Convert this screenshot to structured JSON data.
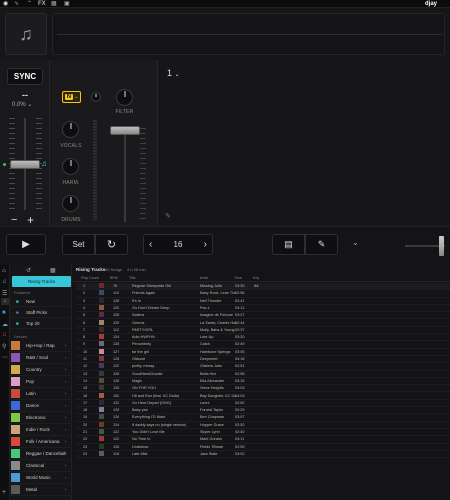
{
  "topbar": {
    "logo": "djay",
    "tabs": [
      "FX"
    ]
  },
  "deck": {
    "sync": "SYNC",
    "bpm": "--",
    "pitch": "0.0%",
    "track_number": "1",
    "neural_mix_badge": "N",
    "vocals": "VOCALS",
    "harmonic": "HARM.",
    "drums": "DRUMS",
    "filter": "FILTER",
    "minus": "−",
    "plus": "+"
  },
  "transport": {
    "play": "▶",
    "set": "Set",
    "loop_value": "16",
    "prev": "‹",
    "next": "›"
  },
  "library": {
    "header_title": "Rising Tracks",
    "header_count": "80 Songs",
    "header_duration": "4 h 28 min",
    "sidebar": {
      "active": "Rising Tracks",
      "featured_label": "Featured",
      "featured": [
        "New",
        "Staff Picks",
        "Top 20"
      ],
      "genres_label": "Genres",
      "genres": [
        "Hip-Hop / Rap",
        "R&B / Soul",
        "Country",
        "Pop",
        "Latin",
        "Dance",
        "Electronic",
        "Indie / Rock",
        "Folk / Americana",
        "Reggae / Dancehall",
        "Classical",
        "World Music",
        "Metal"
      ]
    },
    "columns": [
      "Play Count",
      "BPM",
      "Title",
      "Artist",
      "Time",
      "Key"
    ],
    "rows": [
      {
        "pc": "1",
        "bpm": "76",
        "title": "Regular Sheepside Girl",
        "artist": "Missing Jolla",
        "time": "03:30",
        "key": "8A",
        "c": "#6b2b2b"
      },
      {
        "pc": "2",
        "bpm": "110",
        "title": "Friends Again",
        "artist": "Baby Rock, Lean Thunder",
        "time": "02:58",
        "key": "",
        "c": "#3a4a6a"
      },
      {
        "pc": "3",
        "bpm": "128",
        "title": "It's In",
        "artist": "Neil Thunder",
        "time": "02:41",
        "key": "",
        "c": "#2a2a2a"
      },
      {
        "pc": "4",
        "bpm": "120",
        "title": "Go Don't Dream Deep",
        "artist": "Pav-1",
        "time": "03:12",
        "key": "",
        "c": "#8a5a3a"
      },
      {
        "pc": "5",
        "bpm": "128",
        "title": "Satiera",
        "artist": "Imagine de Fortune",
        "time": "03:27",
        "key": "",
        "c": "#5a2a4a"
      },
      {
        "pc": "6",
        "bpm": "125",
        "title": "Greens",
        "artist": "La Santa, Charlie Hunter",
        "time": "02:44",
        "key": "",
        "c": "#9a8a6a"
      },
      {
        "pc": "7",
        "bpm": "112",
        "title": "PARTYGIRL",
        "artist": "Molly, Babs & Young",
        "time": "02:37",
        "key": "",
        "c": "#3a2a2a"
      },
      {
        "pc": "8",
        "bpm": "124",
        "title": "Adio HWFHN",
        "artist": "Lute-Up",
        "time": "03:20",
        "key": "",
        "c": "#aa3a3a"
      },
      {
        "pc": "9",
        "bpm": "126",
        "title": "Penumbrity",
        "artist": "Catch",
        "time": "02:49",
        "key": "",
        "c": "#6a6a7a"
      },
      {
        "pc": "10",
        "bpm": "127",
        "title": "far the girl",
        "artist": "Hambone Springs",
        "time": "03:05",
        "key": "",
        "c": "#c88aa0"
      },
      {
        "pc": "11",
        "bpm": "128",
        "title": "Oldcore",
        "artist": "Deepmeet",
        "time": "03:18",
        "key": "",
        "c": "#7a3a3a"
      },
      {
        "pc": "12",
        "bpm": "120",
        "title": "pretty, messy",
        "artist": "Glisters Jobs",
        "time": "02:51",
        "key": "",
        "c": "#4a3a5a"
      },
      {
        "pc": "13",
        "bpm": "128",
        "title": "GoodNeedGoodie",
        "artist": "Bella Hex",
        "time": "02:58",
        "key": "",
        "c": "#2a3a4a"
      },
      {
        "pc": "14",
        "bpm": "126",
        "title": "Magic",
        "artist": "Ella Alexander",
        "time": "03:15",
        "key": "",
        "c": "#5a4a3a"
      },
      {
        "pc": "15",
        "bpm": "126",
        "title": "ON FOR YOU",
        "artist": "Steve Heights",
        "time": "03:03",
        "key": "",
        "c": "#3a3a3a"
      },
      {
        "pc": "16",
        "bpm": "100",
        "title": "Hit and Run (feat. KC Dolla)",
        "artist": "Bay Daughter, KC Dolla",
        "time": "04:03",
        "key": "",
        "c": "#aa5a4a"
      },
      {
        "pc": "17",
        "bpm": "122",
        "title": "Go Here Depart (ONG)",
        "artist": "Lenni",
        "time": "02:52",
        "key": "",
        "c": "#2a2a3a"
      },
      {
        "pc": "18",
        "bpm": "128",
        "title": "Baby yes",
        "artist": "Forrest Taylor",
        "time": "02:29",
        "key": "",
        "c": "#8a7a9a"
      },
      {
        "pc": "19",
        "bpm": "126",
        "title": "Everything I'D Want",
        "artist": "Ben Chapman",
        "time": "03:07",
        "key": "",
        "c": "#4a4a4a"
      },
      {
        "pc": "20",
        "bpm": "124",
        "title": "If daddy says no (single version)",
        "artist": "Hopper Grace",
        "time": "02:52",
        "key": "",
        "c": "#6a3a2a"
      },
      {
        "pc": "21",
        "bpm": "122",
        "title": "You Didn't Love Me",
        "artist": "Skyler Lynn",
        "time": "02:40",
        "key": "",
        "c": "#3a5a4a"
      },
      {
        "pc": "22",
        "bpm": "120",
        "title": "No Time In",
        "artist": "Mark Gordon",
        "time": "03:11",
        "key": "",
        "c": "#9a3a3a"
      },
      {
        "pc": "23",
        "bpm": "126",
        "title": "Undertow",
        "artist": "Fields Tillman",
        "time": "02:59",
        "key": "",
        "c": "#2a3a2a"
      },
      {
        "pc": "24",
        "bpm": "118",
        "title": "Late Mist",
        "artist": "Jack Slate",
        "time": "03:02",
        "key": "",
        "c": "#5a5a6a"
      }
    ]
  },
  "colors": {
    "accent": "#38c6d9",
    "badge": "#f5c518",
    "bg": "#111113",
    "panel": "#1c1c1e"
  }
}
